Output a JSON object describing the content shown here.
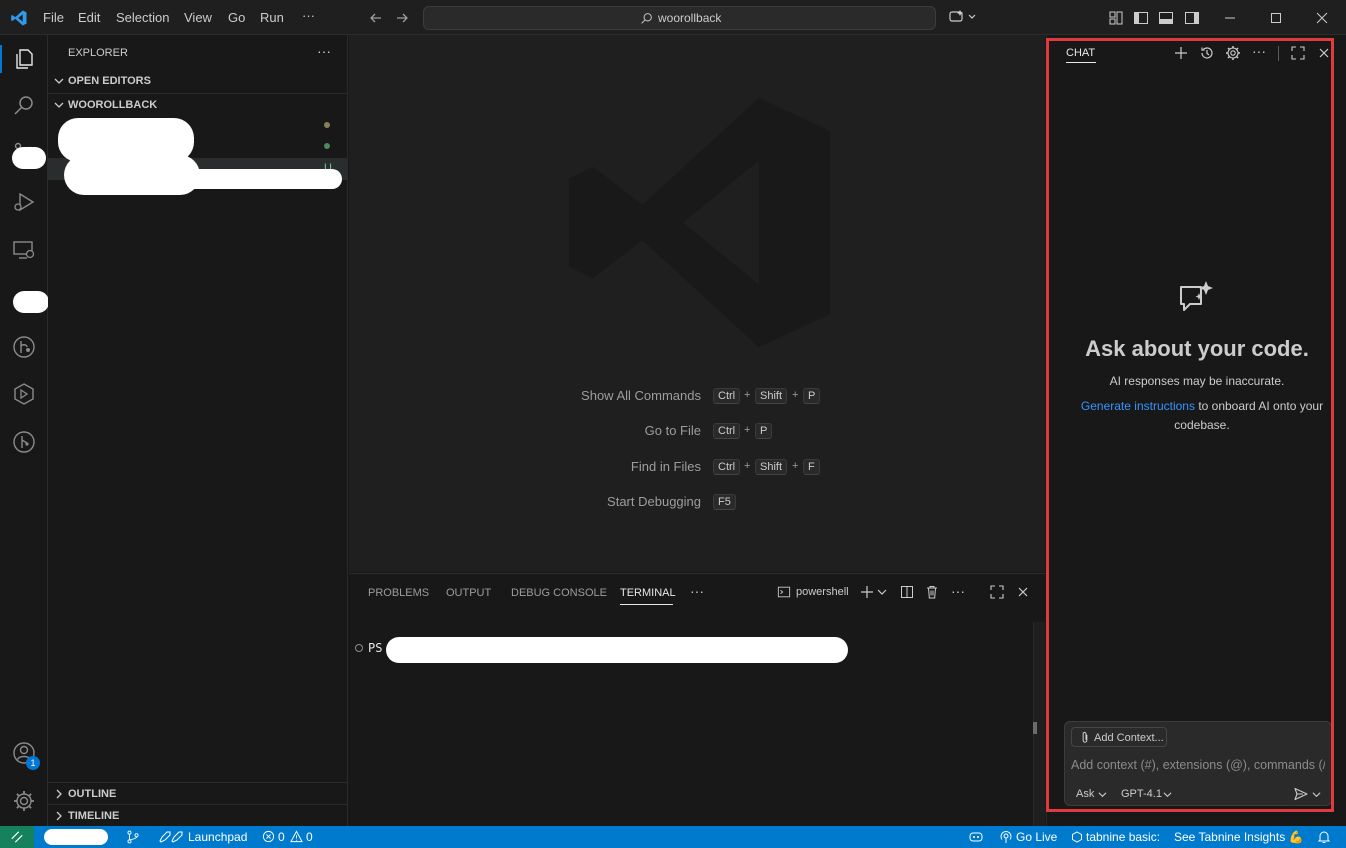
{
  "titlebar": {
    "menu": [
      "File",
      "Edit",
      "Selection",
      "View",
      "Go",
      "Run",
      "···"
    ],
    "search_text": "woorollback"
  },
  "sidebar": {
    "title": "EXPLORER",
    "more": "···",
    "open_editors": "OPEN EDITORS",
    "folder": "WOOROLLBACK",
    "outline": "OUTLINE",
    "timeline": "TIMELINE",
    "file_badge": "U"
  },
  "editor": {
    "shortcuts": [
      {
        "label": "Show All Commands",
        "keys": [
          "Ctrl",
          "Shift",
          "P"
        ]
      },
      {
        "label": "Go to File",
        "keys": [
          "Ctrl",
          "P"
        ]
      },
      {
        "label": "Find in Files",
        "keys": [
          "Ctrl",
          "Shift",
          "F"
        ]
      },
      {
        "label": "Start Debugging",
        "keys": [
          "F5"
        ]
      }
    ],
    "plus": "+"
  },
  "panel": {
    "tabs": [
      "PROBLEMS",
      "OUTPUT",
      "DEBUG CONSOLE",
      "TERMINAL"
    ],
    "active_tab": "TERMINAL",
    "more": "···",
    "shell": "powershell",
    "prompt": "PS"
  },
  "chat": {
    "title": "CHAT",
    "more": "···",
    "heading": "Ask about your code.",
    "disclaimer": "AI responses may be inaccurate.",
    "link": "Generate instructions",
    "link_rest": "to onboard AI onto your",
    "link_rest2": "codebase.",
    "add_context": "Add Context...",
    "input_placeholder": "Add context (#), extensions (@), commands (/)",
    "mode": "Ask",
    "model": "GPT-4.1"
  },
  "statusbar": {
    "launchpad": "Launchpad",
    "errors": "0",
    "warnings": "0",
    "go_live": "Go Live",
    "tabnine": "tabnine basic:",
    "insights": "See Tabnine Insights 💪",
    "accounts_badge": "1"
  },
  "colors": {
    "accent": "#007acc",
    "highlight": "#e0393e",
    "link": "#3794ff"
  }
}
